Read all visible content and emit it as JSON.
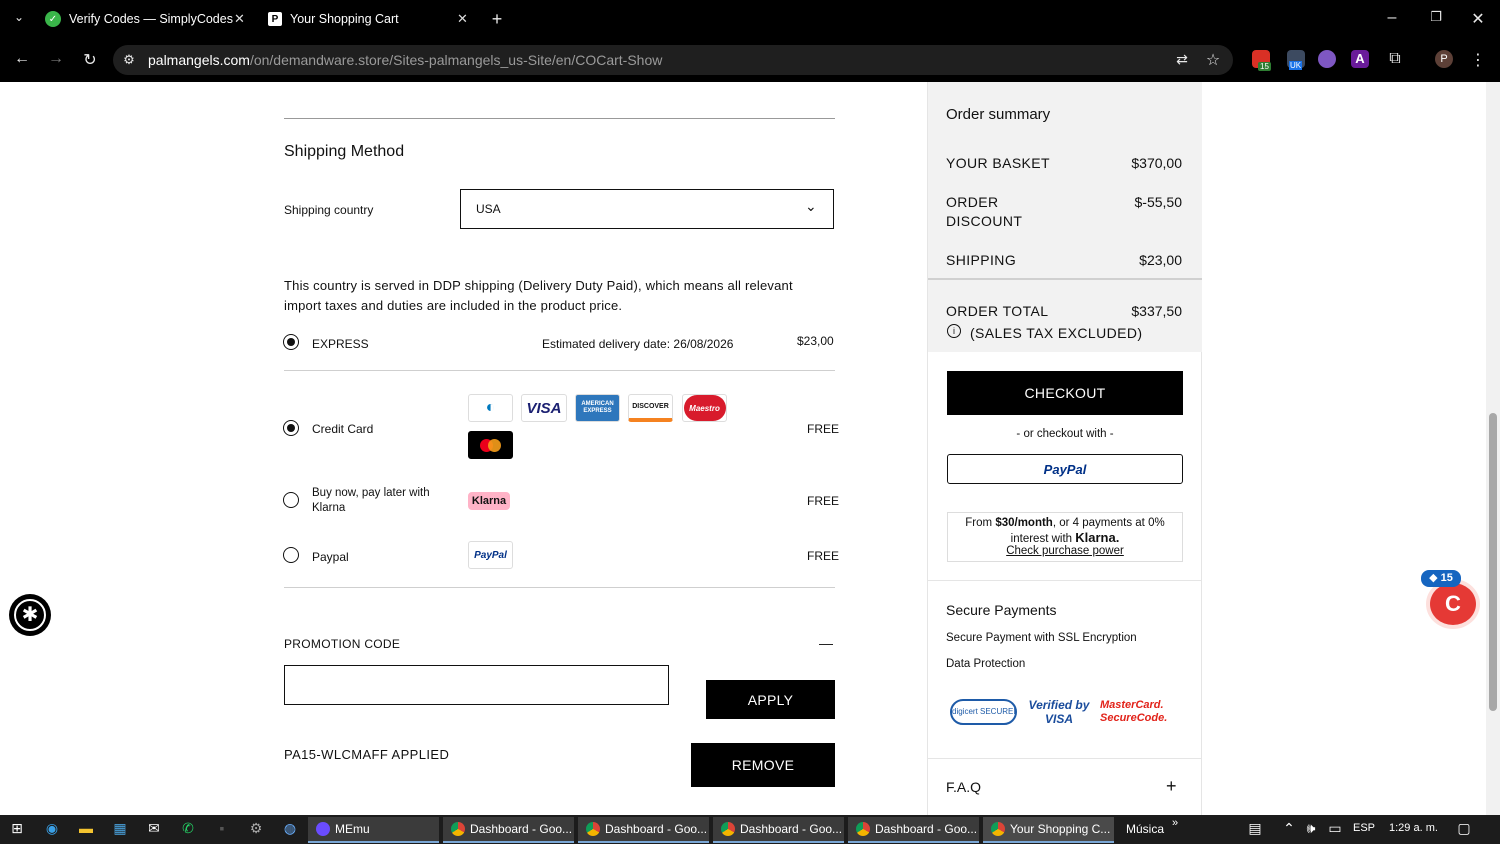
{
  "browser": {
    "tabs": [
      {
        "title": "Verify Codes — SimplyCodes",
        "active": false
      },
      {
        "title": "Your Shopping Cart",
        "active": true
      }
    ],
    "url_host": "palmangels.com",
    "url_path": "/on/demandware.store/Sites-palmangels_us-Site/en/COCart-Show",
    "extension_badge": "15",
    "extension_uk": "UK",
    "profile_initial": "P"
  },
  "shipping": {
    "heading": "Shipping Method",
    "country_label": "Shipping country",
    "country_value": "USA",
    "ddp_note": "This country is served in DDP shipping (Delivery Duty Paid), which means all relevant import taxes and duties are included in the product price.",
    "ddp_line1": "This country is served in DDP shipping (Delivery Duty Paid), which means all relevant",
    "ddp_line2": "import taxes and duties are included in the product price.",
    "method": "EXPRESS",
    "estimate": "Estimated delivery date: 26/08/2026",
    "price": "$23,00"
  },
  "payment": {
    "options": [
      {
        "label": "Credit Card",
        "price": "FREE",
        "selected": true
      },
      {
        "label_line1": "Buy now, pay later with",
        "label_line2": "Klarna",
        "price": "FREE",
        "selected": false
      },
      {
        "label": "Paypal",
        "price": "FREE",
        "selected": false
      }
    ],
    "card_brands": [
      "DINERS",
      "VISA",
      "AMERICAN EXPRESS",
      "DISCOVER",
      "Maestro",
      "mastercard"
    ],
    "klarna_badge": "Klarna",
    "paypal_badge": "PayPal"
  },
  "promo": {
    "label": "PROMOTION CODE",
    "toggle": "—",
    "input_value": "",
    "apply_label": "APPLY",
    "applied_text": "PA15-WLCMAFF APPLIED",
    "remove_label": "REMOVE"
  },
  "summary": {
    "title": "Order summary",
    "basket_label": "YOUR BASKET",
    "basket_value": "$370,00",
    "discount_label_1": "ORDER",
    "discount_label_2": "DISCOUNT",
    "discount_value": "$-55,50",
    "shipping_label": "SHIPPING",
    "shipping_value": "$23,00",
    "total_label": "ORDER TOTAL",
    "total_value": "$337,50",
    "tax_note": "(SALES TAX EXCLUDED)",
    "checkout_label": "CHECKOUT",
    "or_checkout": "- or checkout with -",
    "paypal_label": "PayPal",
    "klarna_prefix": "From ",
    "klarna_amount": "$30/month",
    "klarna_mid": ", or 4 payments at 0%",
    "klarna_line2": "interest with ",
    "klarna_logo": "Klarna.",
    "klarna_link": "Check purchase power"
  },
  "secure": {
    "title": "Secure Payments",
    "line1": "Secure Payment with SSL Encryption",
    "line2": "Data Protection",
    "badges": [
      "digicert SECURED",
      "Verified by VISA",
      "MasterCard. SecureCode."
    ]
  },
  "faq": {
    "label": "F.A.Q",
    "toggle": "+"
  },
  "widget_badge": "15",
  "taskbar": {
    "items": [
      "MEmu",
      "Dashboard - Goo...",
      "Dashboard - Goo...",
      "Dashboard - Goo...",
      "Dashboard - Goo...",
      "Your Shopping C..."
    ],
    "musica": "Música",
    "lang": "ESP",
    "time": "1:29 a. m."
  },
  "colors": {
    "black": "#000000",
    "klarna_pink": "#ffb3c7",
    "paypal_blue": "#003087",
    "summary_bg": "#f2f2f2"
  }
}
